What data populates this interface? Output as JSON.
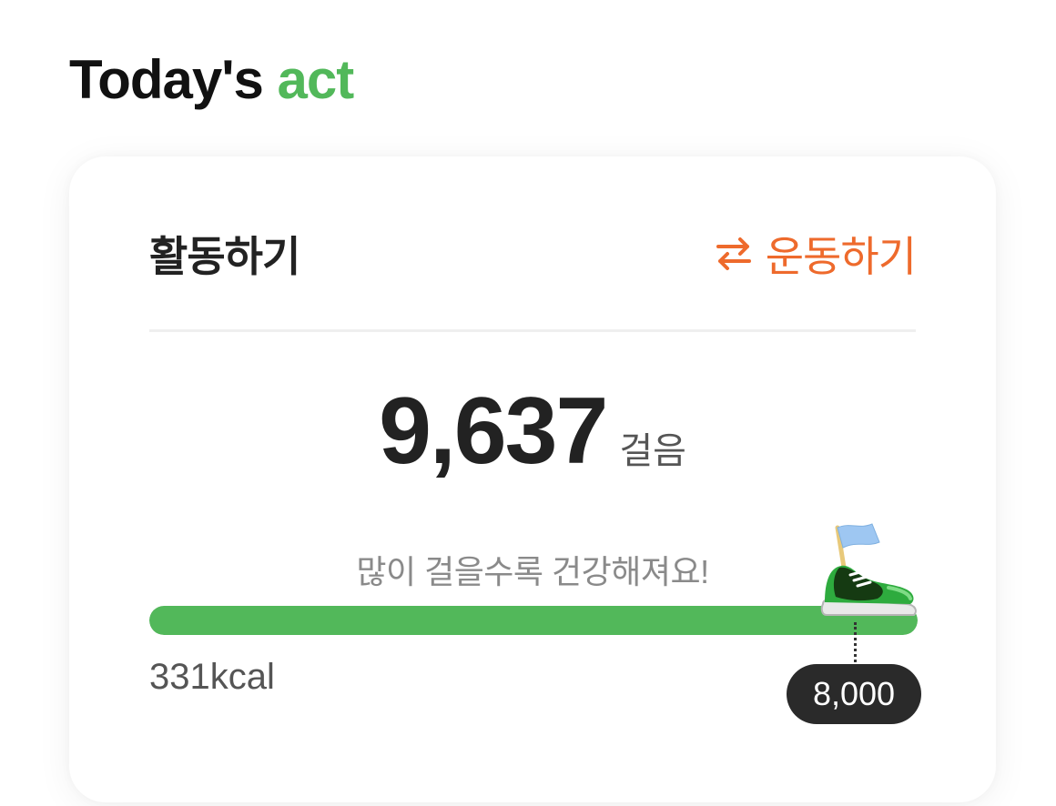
{
  "page_title": {
    "primary": "Today's",
    "accent": "act",
    "accent_color": "#52b85a"
  },
  "card": {
    "section_label": "활동하기",
    "switch": {
      "icon": "swap-arrows-icon",
      "label": "운동하기",
      "color": "#ee6a2c"
    },
    "steps": {
      "count": "9,637",
      "unit": "걸음"
    },
    "encouragement": "많이 걸을수록 건강해져요!",
    "progress": {
      "steps_value": 9637,
      "goal_value": 8000,
      "fill_fraction": 1.0,
      "fill_color": "#52b85a"
    },
    "calories": "331kcal",
    "goal": {
      "label": "8,000",
      "icon": "sneaker-with-flag-icon"
    }
  }
}
